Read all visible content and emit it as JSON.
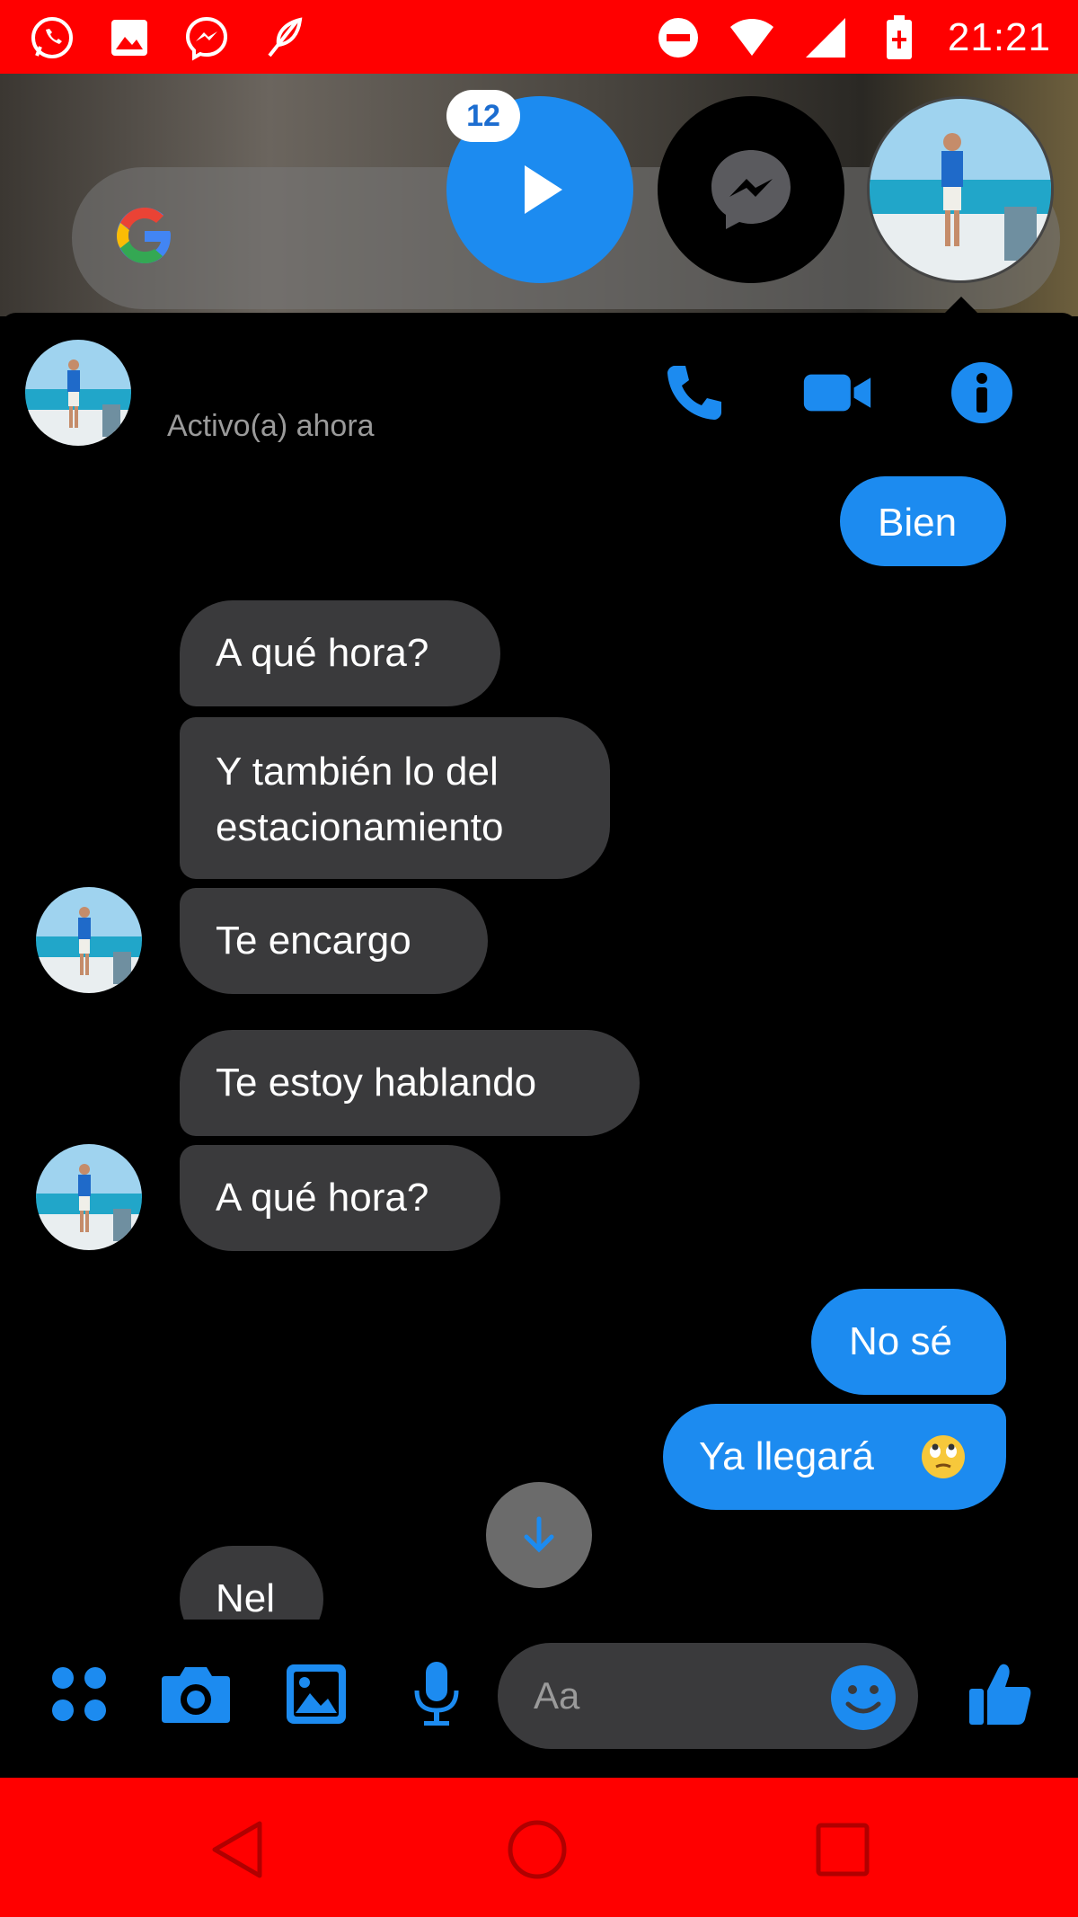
{
  "status_bar": {
    "time": "21:21",
    "left_icons": [
      "whatsapp-icon",
      "gallery-icon",
      "messenger-icon",
      "feather-icon"
    ],
    "right_icons": [
      "do-not-disturb-icon",
      "wifi-icon",
      "signal-icon",
      "battery-icon"
    ]
  },
  "chat_heads": {
    "unread_count": "12"
  },
  "header": {
    "status": "Activo(a) ahora"
  },
  "messages": [
    {
      "side": "out",
      "text": "Bien"
    },
    {
      "side": "in",
      "text": "A qué hora?"
    },
    {
      "side": "in",
      "line1": "Y también lo del",
      "line2": "estacionamiento"
    },
    {
      "side": "in",
      "text": "Te encargo"
    },
    {
      "side": "in",
      "text": "Te estoy hablando"
    },
    {
      "side": "in",
      "text": "A qué hora?"
    },
    {
      "side": "out",
      "text": "No sé"
    },
    {
      "side": "out",
      "text": "Ya llegará"
    },
    {
      "side": "in",
      "text": "Nel"
    }
  ],
  "composer": {
    "placeholder": "Aa"
  },
  "colors": {
    "accent": "#1c8bf0",
    "status_bar": "#ff0000",
    "incoming_bubble": "#3a3a3c",
    "background": "#000000"
  }
}
